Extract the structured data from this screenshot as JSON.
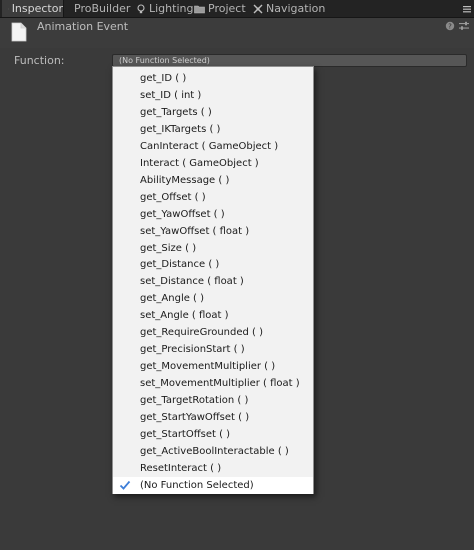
{
  "tabs": [
    {
      "label": "Inspector",
      "active": true
    },
    {
      "label": "ProBuilder",
      "active": false
    },
    {
      "label": "Lighting",
      "active": false
    },
    {
      "label": "Project",
      "active": false
    },
    {
      "label": "Navigation",
      "active": false
    }
  ],
  "header": {
    "title": "Animation Event"
  },
  "function_field": {
    "label": "Function:",
    "value": "(No Function Selected)"
  },
  "menu": {
    "items": [
      "get_ID ( )",
      "set_ID ( int )",
      "get_Targets ( )",
      "get_IKTargets ( )",
      "CanInteract ( GameObject )",
      "Interact ( GameObject )",
      "AbilityMessage ( )",
      "get_Offset ( )",
      "get_YawOffset ( )",
      "set_YawOffset ( float )",
      "get_Size ( )",
      "get_Distance ( )",
      "set_Distance ( float )",
      "get_Angle ( )",
      "set_Angle ( float )",
      "get_RequireGrounded ( )",
      "get_PrecisionStart ( )",
      "get_MovementMultiplier ( )",
      "set_MovementMultiplier ( float )",
      "get_TargetRotation ( )",
      "get_StartYawOffset ( )",
      "get_StartOffset ( )",
      "get_ActiveBoolInteractable ( )",
      "ResetInteract ( )",
      "(No Function Selected)"
    ],
    "selected_index": 24
  },
  "colors": {
    "check": "#3d7ed8",
    "background": "#3a3a3a",
    "menu_bg": "#f2f2f2"
  }
}
